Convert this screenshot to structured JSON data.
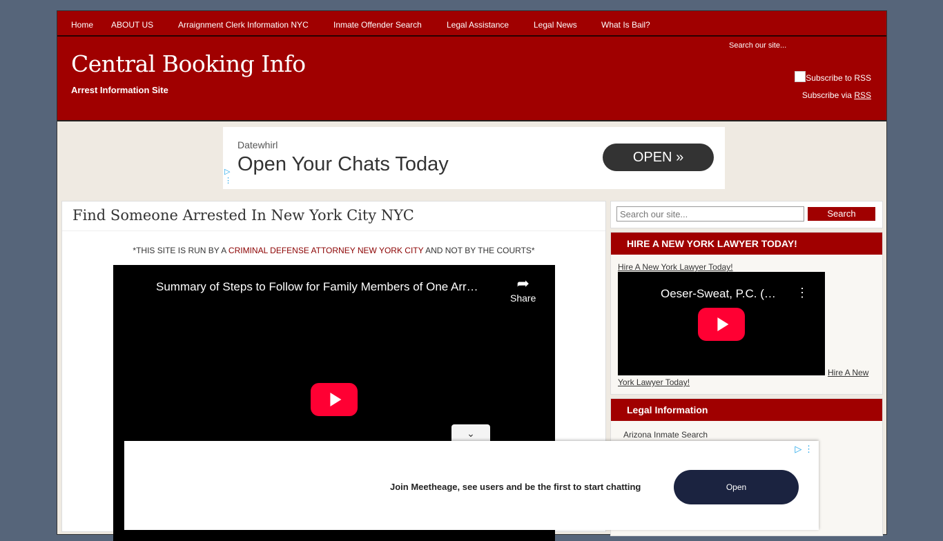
{
  "nav": {
    "items": [
      "Home",
      "ABOUT US",
      "Arraignment Clerk Information NYC",
      "Inmate Offender Search",
      "Legal Assistance",
      "Legal News",
      "What Is Bail?"
    ]
  },
  "header": {
    "title": "Central Booking Info",
    "tagline": "Arrest Information Site",
    "search_placeholder": "Search our site...",
    "rss_image_alt": "Subscribe to RSS",
    "rss_prefix": "Subscribe via",
    "rss_link": "RSS"
  },
  "top_ad": {
    "advertiser": "Datewhirl",
    "headline": "Open Your Chats Today",
    "button": "OPEN",
    "button_icon": "double-chevron-right"
  },
  "main": {
    "post_title": "Find Someone Arrested In New York City NYC",
    "notice_prefix": "*THIS SITE IS RUN BY A",
    "notice_link": "CRIMINAL DEFENSE ATTORNEY NEW YORK CITY",
    "notice_suffix": "AND NOT BY THE COURTS*",
    "video_title": "Summary of Steps to Follow for Family Members of One Arr…",
    "video_share": "Share"
  },
  "sidebar": {
    "search_placeholder": "Search our site...",
    "search_button": "Search",
    "lawyer_widget": {
      "title": "HIRE A NEW YORK LAWYER TODAY!",
      "link_top": "Hire A New York Lawyer Today!",
      "video_title": "Oeser-Sweat, P.C. (…",
      "link_bottom_1": "Hire A New",
      "link_bottom_2": "York Lawyer Today!"
    },
    "legal_widget": {
      "title": "Legal Information",
      "items": [
        "Arizona Inmate Search"
      ]
    }
  },
  "bottom_ad": {
    "message": "Join Meetheage, see users and be the first to start chatting",
    "button": "Open"
  },
  "colors": {
    "brand_red": "#a00000",
    "page_bg": "#56657a",
    "content_bg": "#efeae2",
    "play_red": "#ff0033",
    "ad_button_dark": "#1b2340"
  }
}
